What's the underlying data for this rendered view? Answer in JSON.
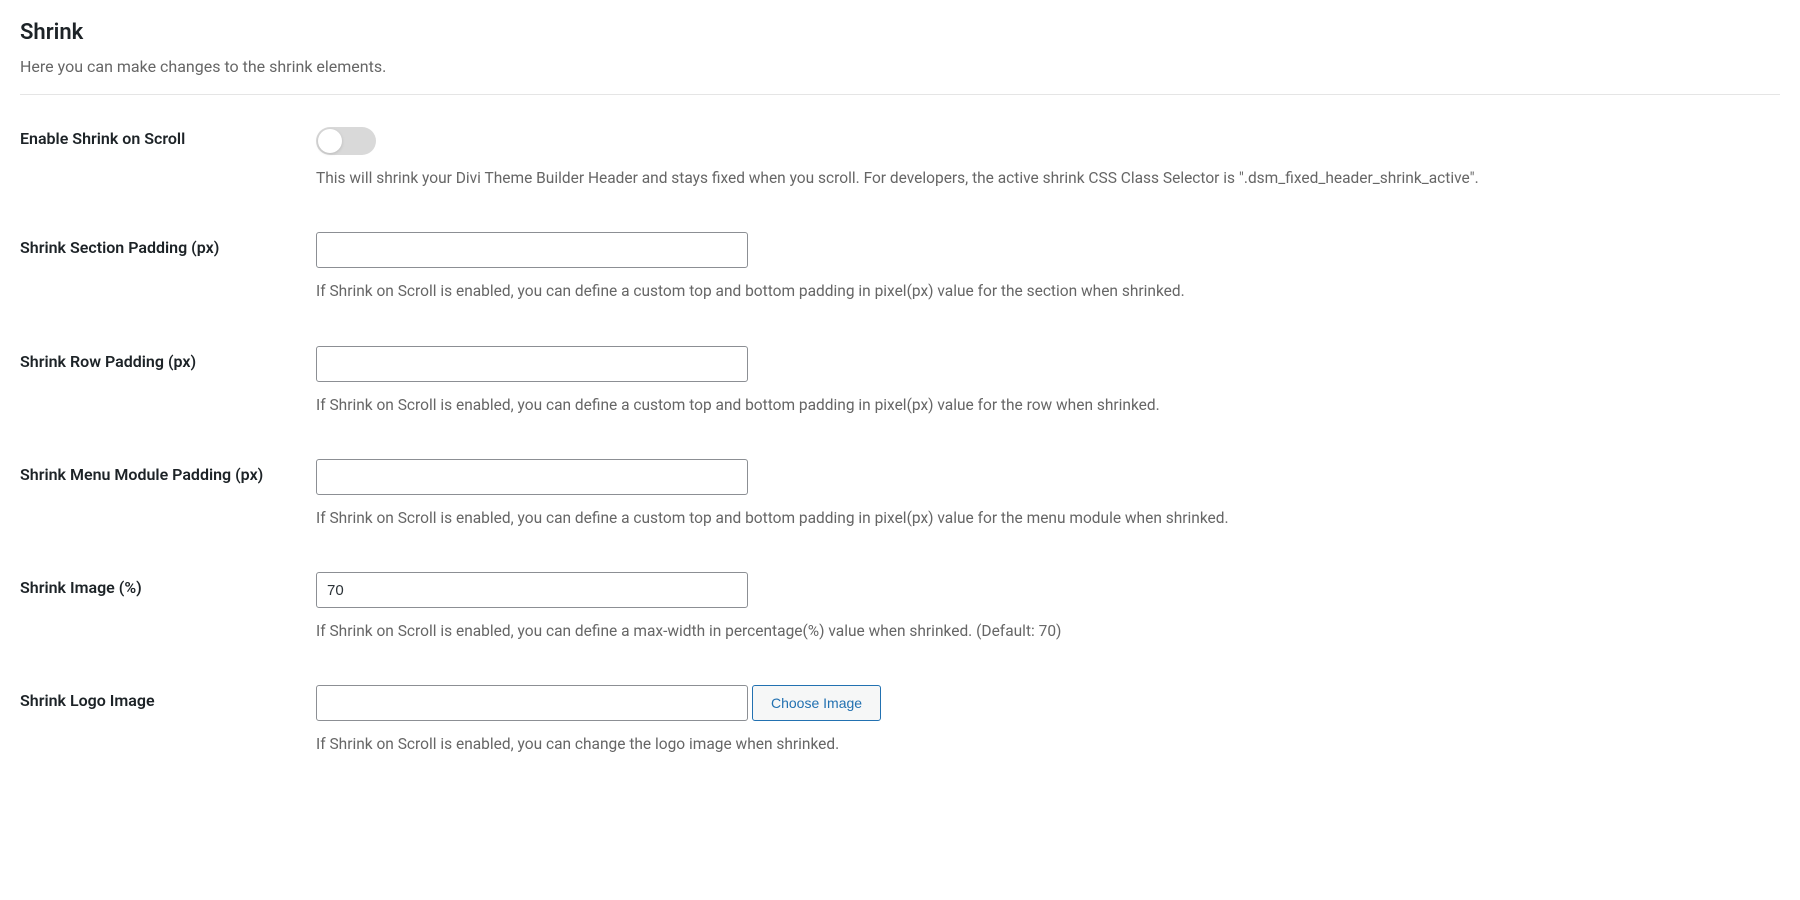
{
  "section": {
    "title": "Shrink",
    "description": "Here you can make changes to the shrink elements."
  },
  "fields": {
    "enable_shrink": {
      "label": "Enable Shrink on Scroll",
      "enabled": false,
      "help": "This will shrink your Divi Theme Builder Header and stays fixed when you scroll. For developers, the active shrink CSS Class Selector is \".dsm_fixed_header_shrink_active\"."
    },
    "section_padding": {
      "label": "Shrink Section Padding (px)",
      "value": "",
      "help": "If Shrink on Scroll is enabled, you can define a custom top and bottom padding in pixel(px) value for the section when shrinked."
    },
    "row_padding": {
      "label": "Shrink Row Padding (px)",
      "value": "",
      "help": "If Shrink on Scroll is enabled, you can define a custom top and bottom padding in pixel(px) value for the row when shrinked."
    },
    "menu_padding": {
      "label": "Shrink Menu Module Padding (px)",
      "value": "",
      "help": "If Shrink on Scroll is enabled, you can define a custom top and bottom padding in pixel(px) value for the menu module when shrinked."
    },
    "image_percent": {
      "label": "Shrink Image (%)",
      "value": "70",
      "help": "If Shrink on Scroll is enabled, you can define a max-width in percentage(%) value when shrinked. (Default: 70)"
    },
    "logo_image": {
      "label": "Shrink Logo Image",
      "value": "",
      "button": "Choose Image",
      "help": "If Shrink on Scroll is enabled, you can change the logo image when shrinked."
    }
  }
}
